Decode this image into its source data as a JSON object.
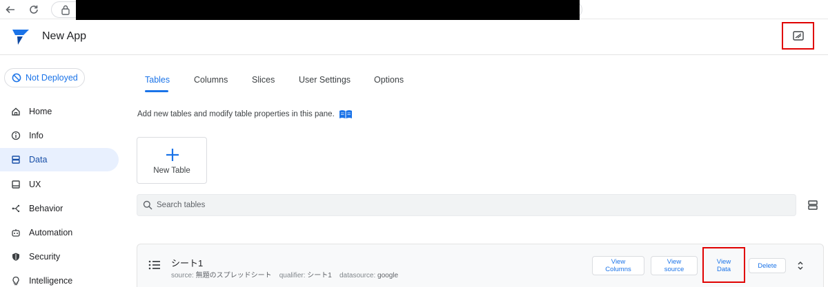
{
  "app": {
    "title": "New App"
  },
  "deploy": {
    "status": "Not Deployed"
  },
  "sidebar": {
    "items": [
      {
        "label": "Home",
        "icon": "home-icon"
      },
      {
        "label": "Info",
        "icon": "info-icon"
      },
      {
        "label": "Data",
        "icon": "data-icon",
        "active": true
      },
      {
        "label": "UX",
        "icon": "ux-icon"
      },
      {
        "label": "Behavior",
        "icon": "behavior-icon"
      },
      {
        "label": "Automation",
        "icon": "automation-icon"
      },
      {
        "label": "Security",
        "icon": "shield-icon"
      },
      {
        "label": "Intelligence",
        "icon": "bulb-icon"
      }
    ]
  },
  "tabs": [
    {
      "label": "Tables",
      "active": true
    },
    {
      "label": "Columns"
    },
    {
      "label": "Slices"
    },
    {
      "label": "User Settings"
    },
    {
      "label": "Options"
    }
  ],
  "main": {
    "hint": "Add new tables and modify table properties in this pane.",
    "new_table_label": "New Table",
    "search_placeholder": "Search tables"
  },
  "table": {
    "name": "シート1",
    "source_label": "source:",
    "source_value": "無題のスプレッドシート",
    "qualifier_label": "qualifier:",
    "qualifier_value": "シート1",
    "datasource_label": "datasource:",
    "datasource_value": "google",
    "actions": {
      "view_columns": [
        "View",
        "Columns"
      ],
      "view_source": [
        "View",
        "source"
      ],
      "view_data": [
        "View",
        "Data"
      ],
      "delete": "Delete"
    }
  },
  "colors": {
    "accent": "#1a73e8",
    "highlight": "#e00000",
    "active_bg": "#e8f0fe"
  }
}
